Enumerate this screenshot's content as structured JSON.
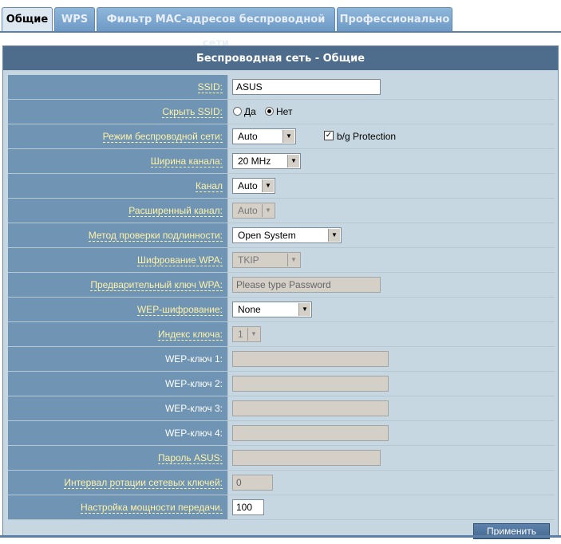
{
  "tabs": [
    {
      "label": "Общие",
      "active": true
    },
    {
      "label": "WPS",
      "active": false
    },
    {
      "label": "Фильтр MAC-адресов беспроводной сети",
      "active": false
    },
    {
      "label": "Профессионально",
      "active": false
    }
  ],
  "panel": {
    "title": "Беспроводная сеть - Общие",
    "apply_label": "Применить"
  },
  "fields": {
    "ssid": {
      "label": "SSID:",
      "value": "ASUS"
    },
    "hide_ssid": {
      "label": "Скрыть SSID:",
      "yes": "Да",
      "no": "Нет",
      "selected": "Нет"
    },
    "wireless_mode": {
      "label": "Режим беспроводной сети:",
      "value": "Auto",
      "protection_label": "b/g Protection",
      "protection_checked": true
    },
    "channel_width": {
      "label": "Ширина канала:",
      "value": "20 MHz"
    },
    "channel": {
      "label": "Канал",
      "value": "Auto"
    },
    "ext_channel": {
      "label": "Расширенный канал:",
      "value": "Auto"
    },
    "auth_method": {
      "label": "Метод проверки подлинности:",
      "value": "Open System"
    },
    "wpa_encryption": {
      "label": "Шифрование WPA:",
      "value": "TKIP"
    },
    "wpa_psk": {
      "label": "Предварительный ключ WPA:",
      "placeholder": "Please type Password"
    },
    "wep_encryption": {
      "label": "WEP-шифрование:",
      "value": "None"
    },
    "key_index": {
      "label": "Индекс ключа:",
      "value": "1"
    },
    "wep_key1": {
      "label": "WEP-ключ 1:",
      "value": ""
    },
    "wep_key2": {
      "label": "WEP-ключ 2:",
      "value": ""
    },
    "wep_key3": {
      "label": "WEP-ключ 3:",
      "value": ""
    },
    "wep_key4": {
      "label": "WEP-ключ 4:",
      "value": ""
    },
    "asus_password": {
      "label": "Пароль ASUS:",
      "value": ""
    },
    "key_rotation": {
      "label": "Интервал ротации сетевых ключей:",
      "value": "0"
    },
    "tx_power": {
      "label": "Настройка мощности передачи.",
      "value": "100"
    }
  },
  "colors": {
    "tab_active_bg": "#dde7ef",
    "tab_inactive_bg": "#7aa3cc",
    "panel_header_bg": "#4e6d8c",
    "label_bg": "#6f94b4",
    "label_text": "#fff3a6",
    "value_bg": "#c6d7e1"
  }
}
